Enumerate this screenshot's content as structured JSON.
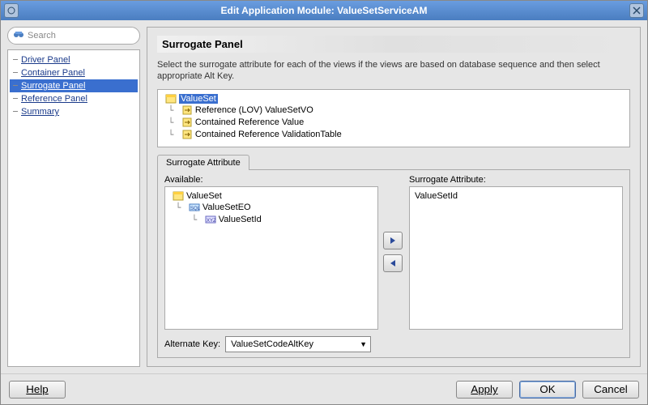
{
  "window": {
    "title": "Edit Application Module: ValueSetServiceAM"
  },
  "sidebar": {
    "search_placeholder": "Search",
    "items": [
      {
        "label": "Driver Panel",
        "selected": false
      },
      {
        "label": "Container Panel",
        "selected": false
      },
      {
        "label": "Surrogate Panel",
        "selected": true
      },
      {
        "label": "Reference Panel",
        "selected": false
      },
      {
        "label": "Summary",
        "selected": false
      }
    ]
  },
  "main": {
    "title": "Surrogate Panel",
    "description": "Select the surrogate attribute for each of the views if the views are based on database sequence and then select appropriate Alt Key.",
    "tree": [
      {
        "label": "ValueSet",
        "indent": 0,
        "icon": "entity",
        "selected": true
      },
      {
        "label": "Reference (LOV) ValueSetVO",
        "indent": 1,
        "icon": "ref"
      },
      {
        "label": "Contained Reference Value",
        "indent": 1,
        "icon": "ref"
      },
      {
        "label": "Contained Reference ValidationTable",
        "indent": 1,
        "icon": "ref"
      }
    ],
    "tab": "Surrogate Attribute",
    "available_label": "Available:",
    "selected_label": "Surrogate Attribute:",
    "available": [
      {
        "label": "ValueSet",
        "indent": 0,
        "icon": "entity"
      },
      {
        "label": "ValueSetEO",
        "indent": 1,
        "icon": "sql"
      },
      {
        "label": "ValueSetId",
        "indent": 2,
        "icon": "xyz"
      }
    ],
    "selected": [
      {
        "label": "ValueSetId"
      }
    ],
    "alt_key_label": "Alternate Key:",
    "alt_key_value": "ValueSetCodeAltKey"
  },
  "footer": {
    "help": "Help",
    "apply": "Apply",
    "ok": "OK",
    "cancel": "Cancel"
  }
}
